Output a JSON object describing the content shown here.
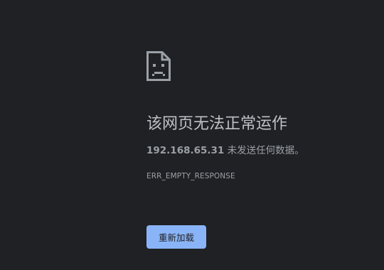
{
  "error": {
    "icon": "sad-page-icon",
    "title": "该网页无法正常运作",
    "host": "192.168.65.31",
    "message": " 未发送任何数据。",
    "code": "ERR_EMPTY_RESPONSE"
  },
  "actions": {
    "reload_label": "重新加载"
  },
  "colors": {
    "background": "#202124",
    "title": "#bdc1c6",
    "text": "#9aa0a6",
    "button": "#8ab4f8"
  }
}
